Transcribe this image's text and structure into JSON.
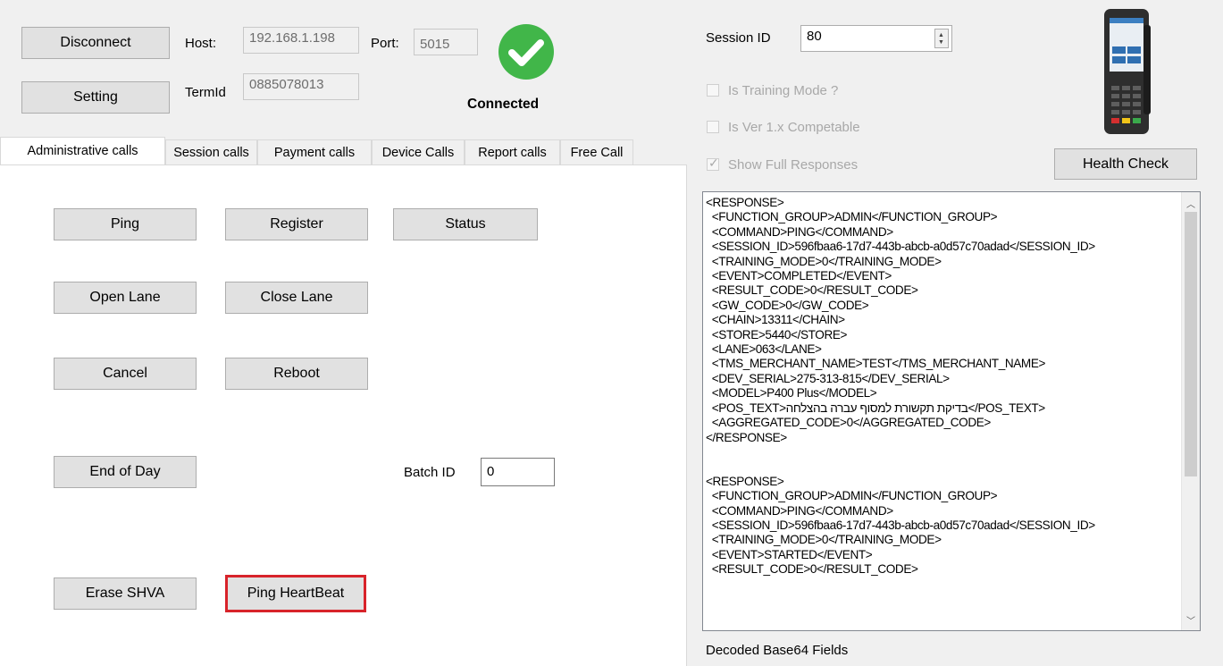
{
  "connection": {
    "disconnect_label": "Disconnect",
    "setting_label": "Setting",
    "host_label": "Host:",
    "host_value": "192.168.1.198",
    "port_label": "Port:",
    "port_value": "5015",
    "termid_label": "TermId",
    "termid_value": "0885078013",
    "status_text": "Connected",
    "status_color": "#41b649"
  },
  "tabs": [
    {
      "label": "Administrative calls",
      "active": true
    },
    {
      "label": "Session calls"
    },
    {
      "label": "Payment calls"
    },
    {
      "label": "Device Calls"
    },
    {
      "label": "Report calls"
    },
    {
      "label": "Free Call"
    }
  ],
  "admin_buttons": {
    "ping": "Ping",
    "register": "Register",
    "status": "Status",
    "open_lane": "Open Lane",
    "close_lane": "Close Lane",
    "cancel": "Cancel",
    "reboot": "Reboot",
    "end_of_day": "End of Day",
    "erase_shva": "Erase SHVA",
    "ping_heartbeat": "Ping HeartBeat",
    "highlight_color": "#d8232a"
  },
  "batch": {
    "label": "Batch ID",
    "value": "0"
  },
  "session": {
    "label": "Session ID",
    "value": "80"
  },
  "options": {
    "training_mode": "Is Training Mode ?",
    "ver1x": "Is Ver 1.x Competable",
    "show_full": "Show Full Responses"
  },
  "health_check_label": "Health Check",
  "response_text": "<RESPONSE>\n  <FUNCTION_GROUP>ADMIN</FUNCTION_GROUP>\n  <COMMAND>PING</COMMAND>\n  <SESSION_ID>596fbaa6-17d7-443b-abcb-a0d57c70adad</SESSION_ID>\n  <TRAINING_MODE>0</TRAINING_MODE>\n  <EVENT>COMPLETED</EVENT>\n  <RESULT_CODE>0</RESULT_CODE>\n  <GW_CODE>0</GW_CODE>\n  <CHAIN>13311</CHAIN>\n  <STORE>5440</STORE>\n  <LANE>063</LANE>\n  <TMS_MERCHANT_NAME>TEST</TMS_MERCHANT_NAME>\n  <DEV_SERIAL>275-313-815</DEV_SERIAL>\n  <MODEL>P400 Plus</MODEL>\n  <POS_TEXT>בדיקת תקשורת למסוף עברה בהצלחה</POS_TEXT>\n  <AGGREGATED_CODE>0</AGGREGATED_CODE>\n</RESPONSE>\n\n\n<RESPONSE>\n  <FUNCTION_GROUP>ADMIN</FUNCTION_GROUP>\n  <COMMAND>PING</COMMAND>\n  <SESSION_ID>596fbaa6-17d7-443b-abcb-a0d57c70adad</SESSION_ID>\n  <TRAINING_MODE>0</TRAINING_MODE>\n  <EVENT>STARTED</EVENT>\n  <RESULT_CODE>0</RESULT_CODE>",
  "decoded_label": "Decoded Base64 Fields"
}
